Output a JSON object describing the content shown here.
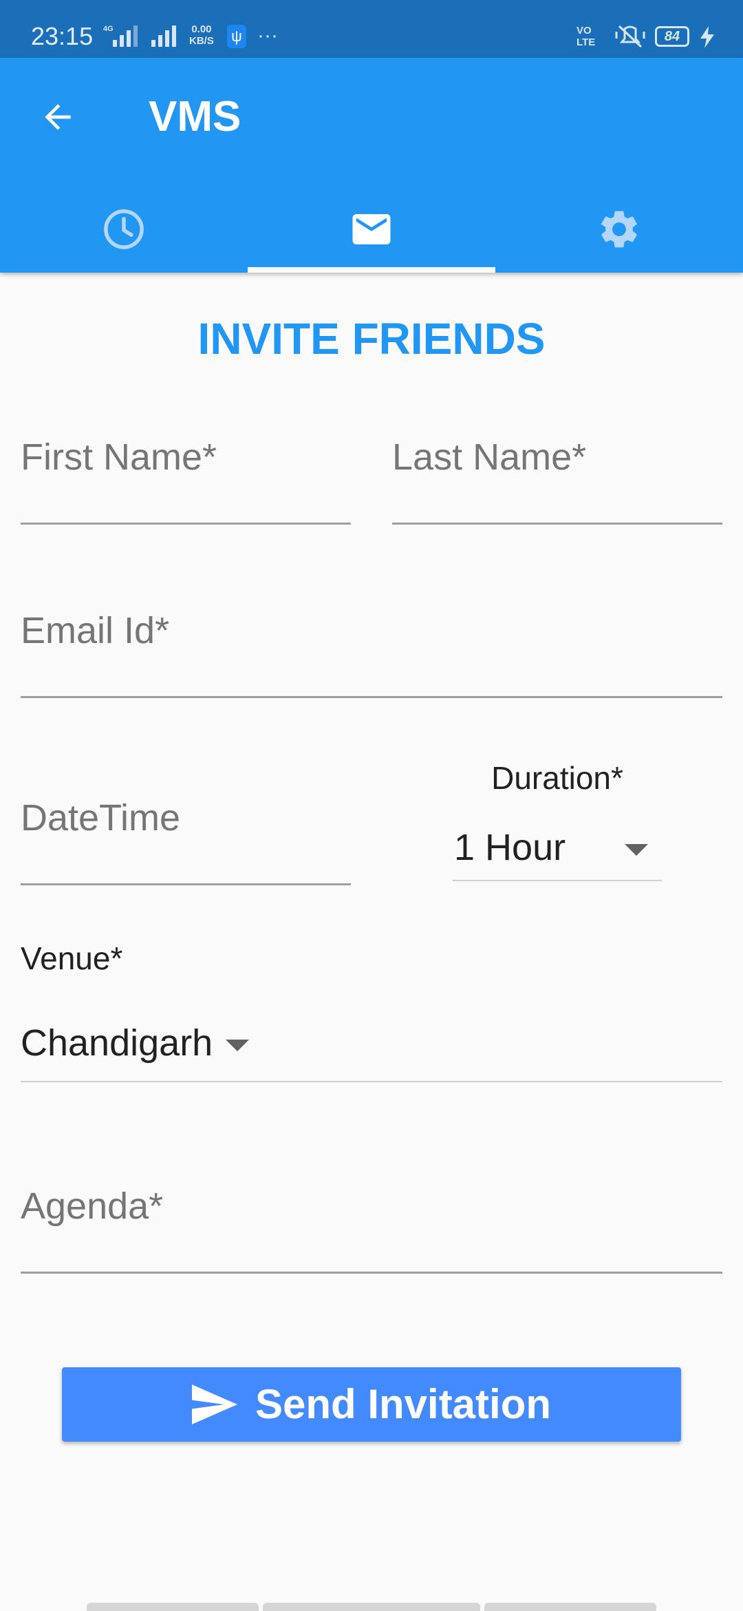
{
  "status_bar": {
    "time": "23:15",
    "network_type": "4G",
    "speed_value": "0.00",
    "speed_unit": "KB/S",
    "more": "···",
    "volte": "VO\nLTE",
    "battery": "84"
  },
  "app_bar": {
    "title": "VMS",
    "back_icon": "arrow-back-icon",
    "tabs": [
      {
        "icon": "clock-icon",
        "selected": false
      },
      {
        "icon": "mail-icon",
        "selected": true
      },
      {
        "icon": "gear-icon",
        "selected": false
      }
    ]
  },
  "form": {
    "heading": "INVITE FRIENDS",
    "first_name_placeholder": "First Name*",
    "last_name_placeholder": "Last Name*",
    "email_placeholder": "Email Id*",
    "datetime_placeholder": "DateTime",
    "duration_label": "Duration*",
    "duration_value": "1 Hour",
    "venue_label": "Venue*",
    "venue_value": "Chandigarh",
    "agenda_placeholder": "Agenda*",
    "send_label": "Send Invitation"
  },
  "colors": {
    "status_bar": "#1b6fb8",
    "primary": "#2196f3",
    "button": "#448aff",
    "background": "#fafafa"
  }
}
